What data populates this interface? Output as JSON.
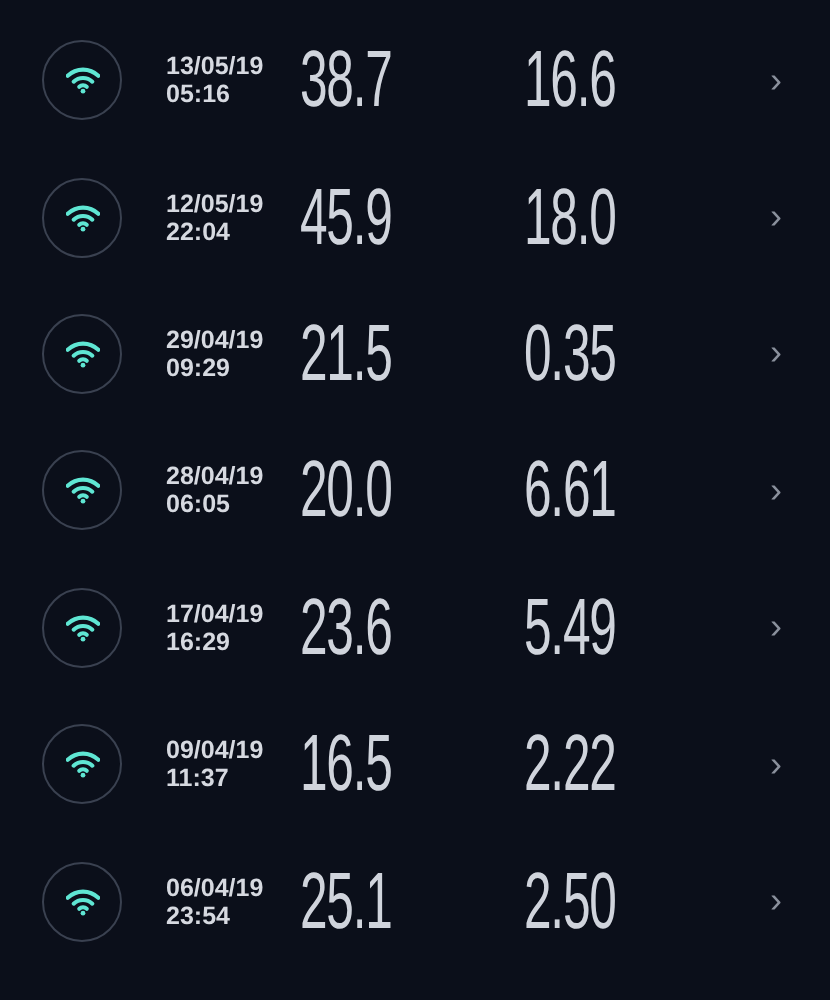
{
  "results": [
    {
      "date": "13/05/19",
      "time": "05:16",
      "download": "38.7",
      "upload": "16.6",
      "chevron": "›"
    },
    {
      "date": "12/05/19",
      "time": "22:04",
      "download": "45.9",
      "upload": "18.0",
      "chevron": "›"
    },
    {
      "date": "29/04/19",
      "time": "09:29",
      "download": "21.5",
      "upload": "0.35",
      "chevron": "›"
    },
    {
      "date": "28/04/19",
      "time": "06:05",
      "download": "20.0",
      "upload": "6.61",
      "chevron": "›"
    },
    {
      "date": "17/04/19",
      "time": "16:29",
      "download": "23.6",
      "upload": "5.49",
      "chevron": "›"
    },
    {
      "date": "09/04/19",
      "time": "11:37",
      "download": "16.5",
      "upload": "2.22",
      "chevron": "›"
    },
    {
      "date": "06/04/19",
      "time": "23:54",
      "download": "25.1",
      "upload": "2.50",
      "chevron": "›"
    }
  ]
}
